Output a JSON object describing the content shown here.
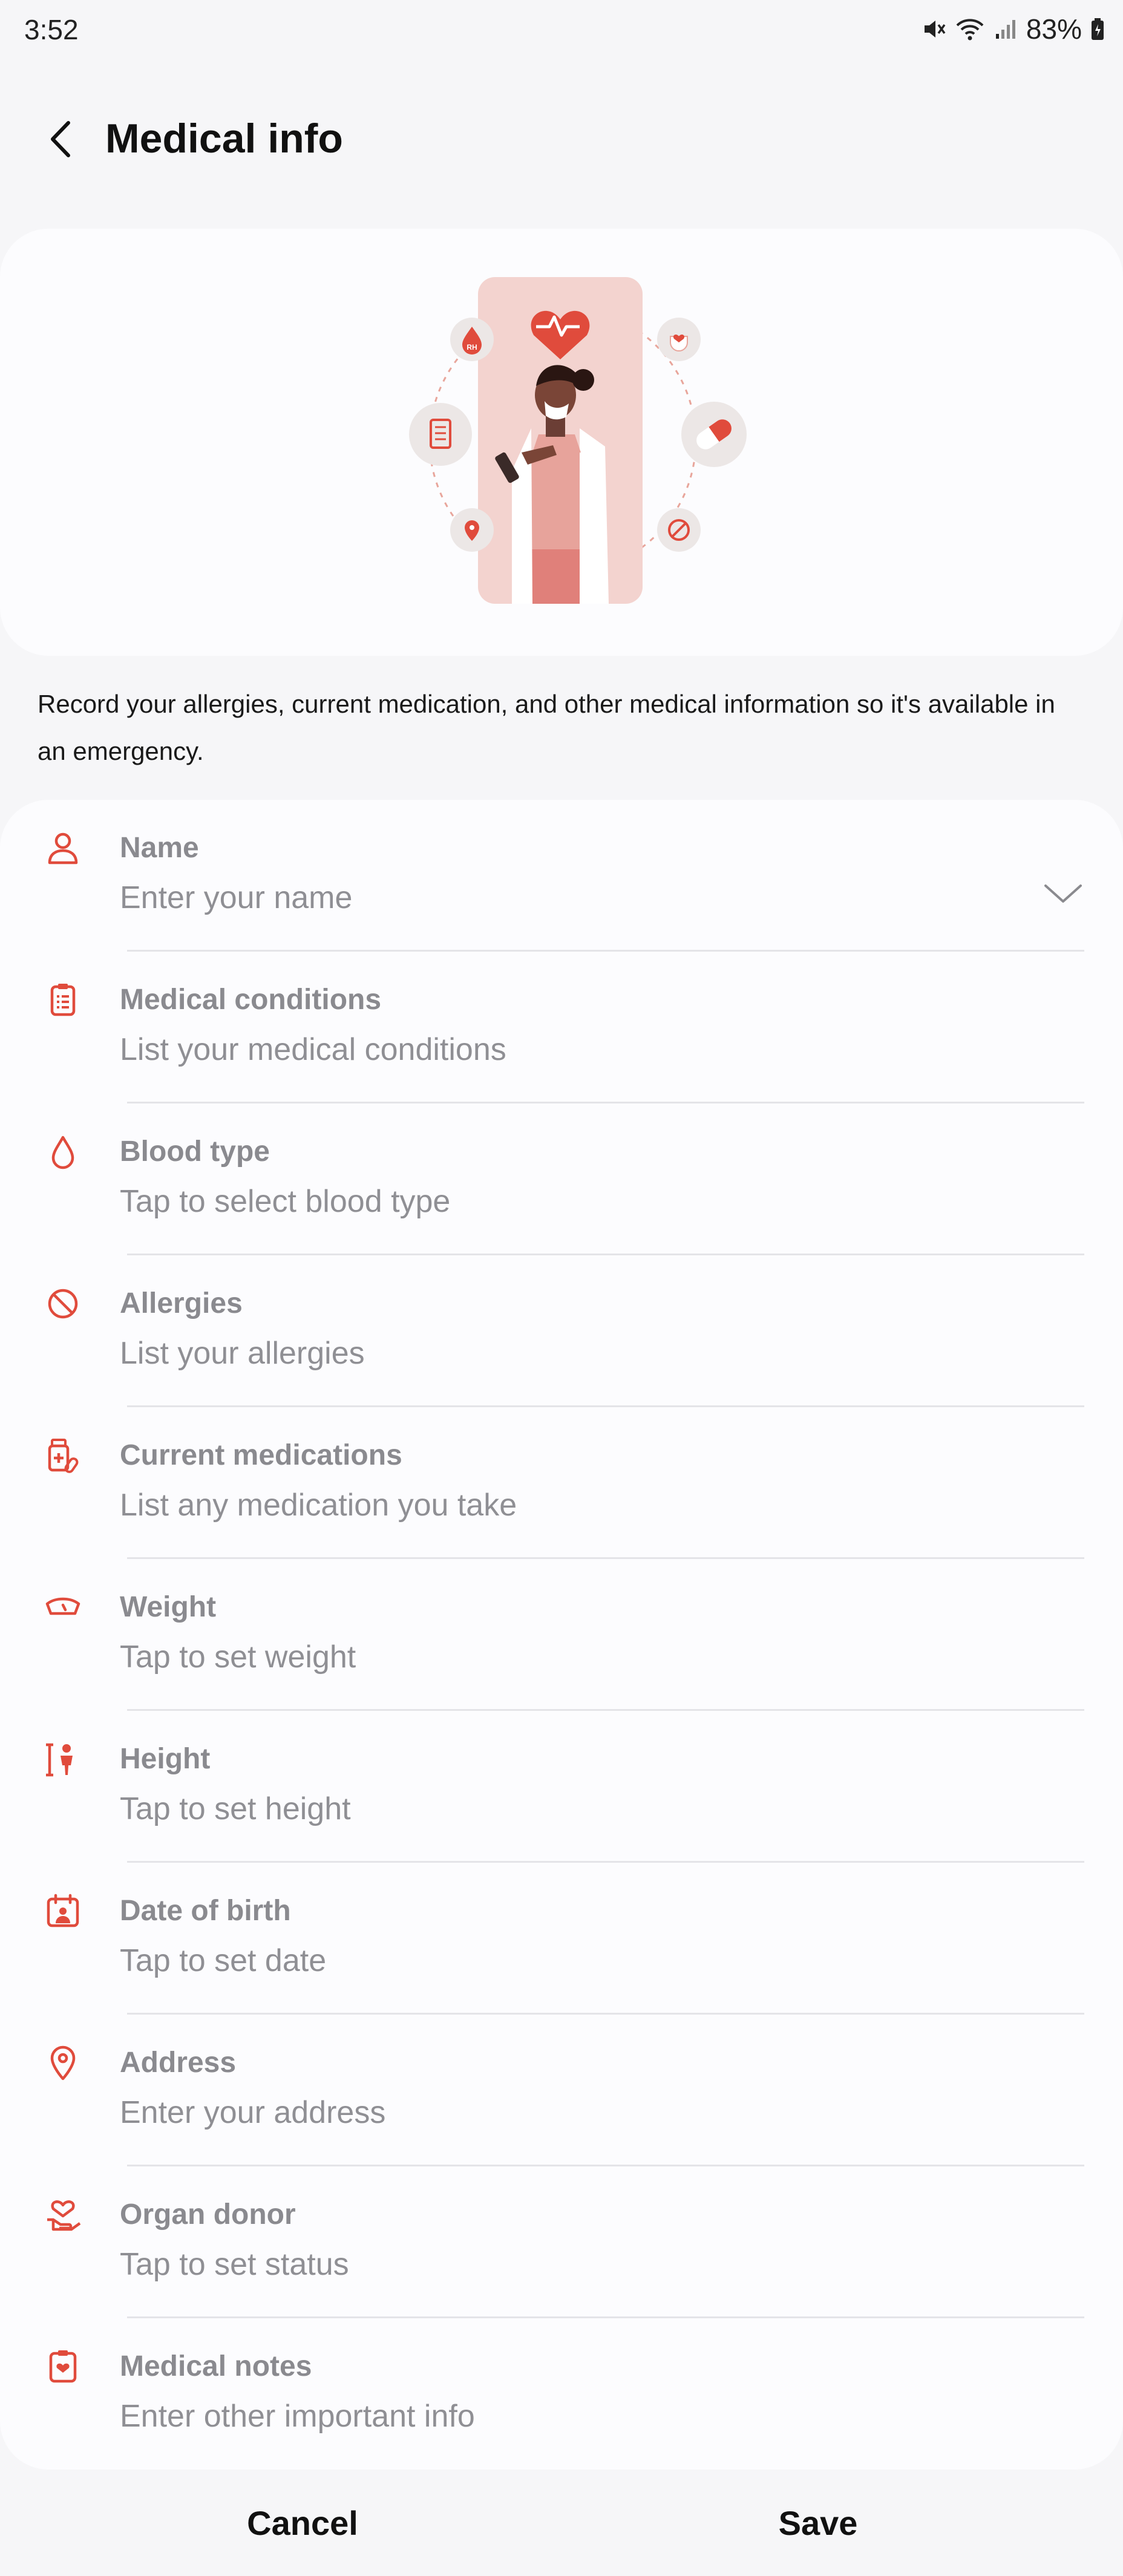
{
  "status": {
    "time": "3:52",
    "battery": "83%"
  },
  "header": {
    "title": "Medical info"
  },
  "intro": "Record your allergies, current medication, and other medical information so it's available in an emergency.",
  "colors": {
    "accent": "#e04b3c",
    "background": "#f6f6f8",
    "card": "#fcfcfe"
  },
  "fields": [
    {
      "label": "Name",
      "value": "Enter your name",
      "icon": "person-icon"
    },
    {
      "label": "Medical conditions",
      "value": "List your medical conditions",
      "icon": "clipboard-list-icon"
    },
    {
      "label": "Blood type",
      "value": "Tap to select blood type",
      "icon": "blood-drop-icon"
    },
    {
      "label": "Allergies",
      "value": "List your allergies",
      "icon": "prohibited-icon"
    },
    {
      "label": "Current medications",
      "value": "List any medication you take",
      "icon": "medication-icon"
    },
    {
      "label": "Weight",
      "value": "Tap to set weight",
      "icon": "scale-icon"
    },
    {
      "label": "Height",
      "value": "Tap to set height",
      "icon": "height-icon"
    },
    {
      "label": "Date of birth",
      "value": "Tap to set date",
      "icon": "calendar-person-icon"
    },
    {
      "label": "Address",
      "value": "Enter your address",
      "icon": "location-pin-icon"
    },
    {
      "label": "Organ donor",
      "value": "Tap to set status",
      "icon": "heart-hand-icon"
    },
    {
      "label": "Medical notes",
      "value": "Enter other important info",
      "icon": "medical-notes-icon"
    }
  ],
  "actions": {
    "cancel": "Cancel",
    "save": "Save"
  },
  "illustration": {
    "blood_badge": "RH"
  }
}
